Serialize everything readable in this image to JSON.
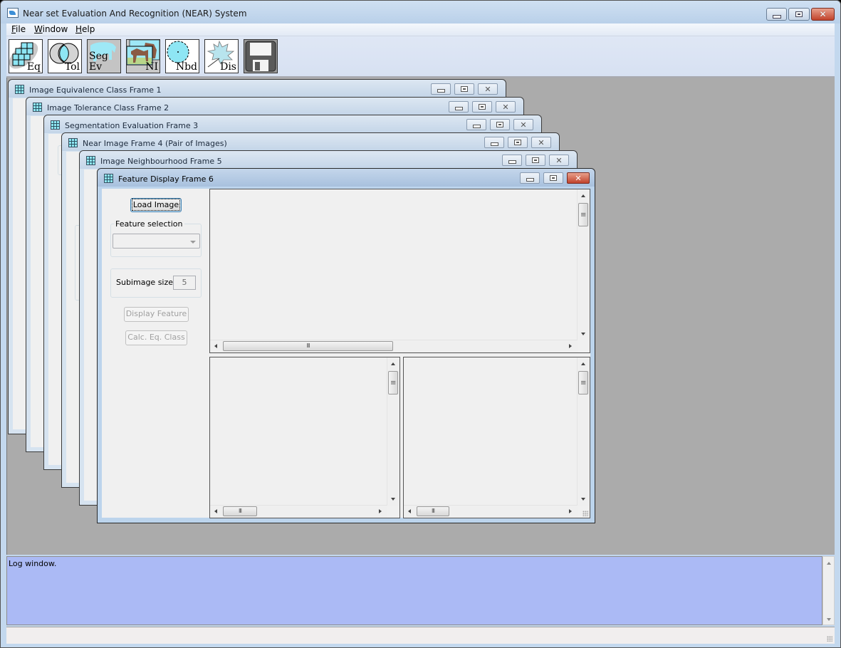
{
  "app": {
    "title": "Near set Evaluation And Recognition (NEAR) System",
    "window_controls": {
      "minimize": "minimize",
      "maximize": "maximize",
      "close": "close"
    }
  },
  "menubar": {
    "items": [
      {
        "label": "File",
        "mnemonic": "F"
      },
      {
        "label": "Window",
        "mnemonic": "W"
      },
      {
        "label": "Help",
        "mnemonic": "H"
      }
    ]
  },
  "toolbar": {
    "buttons": [
      {
        "label": "Eq",
        "icon": "equivalence-class-icon"
      },
      {
        "label": "Tol",
        "icon": "tolerance-class-icon"
      },
      {
        "label": "Seg Ev",
        "icon": "segmentation-evaluation-icon"
      },
      {
        "label": "NI",
        "icon": "near-images-icon"
      },
      {
        "label": "Nbd",
        "icon": "neighbourhood-icon"
      },
      {
        "label": "Dis",
        "icon": "feature-display-icon"
      },
      {
        "label": "",
        "icon": "save-icon"
      }
    ]
  },
  "internal_frames": [
    {
      "title": "Image Equivalence Class Frame 1"
    },
    {
      "title": "Image Tolerance Class Frame 2"
    },
    {
      "title": "Segmentation Evaluation Frame 3"
    },
    {
      "title": "Near Image Frame 4 (Pair of Images)"
    },
    {
      "title": "Image Neighbourhood Frame 5"
    },
    {
      "title": "Feature Display Frame 6"
    }
  ],
  "feature_frame": {
    "load_image_label": "Load Image",
    "feature_selection_legend": "Feature selection",
    "feature_selection_value": "",
    "subimage_size_label": "Subimage size:",
    "subimage_size_value": "5",
    "display_feature_label": "Display Feature",
    "calc_eq_class_label": "Calc. Eq. Class"
  },
  "log": {
    "text": "Log window."
  },
  "colors": {
    "log_background": "#abbaf5",
    "desktop_background": "#ababab",
    "close_button": "#c1432c"
  }
}
